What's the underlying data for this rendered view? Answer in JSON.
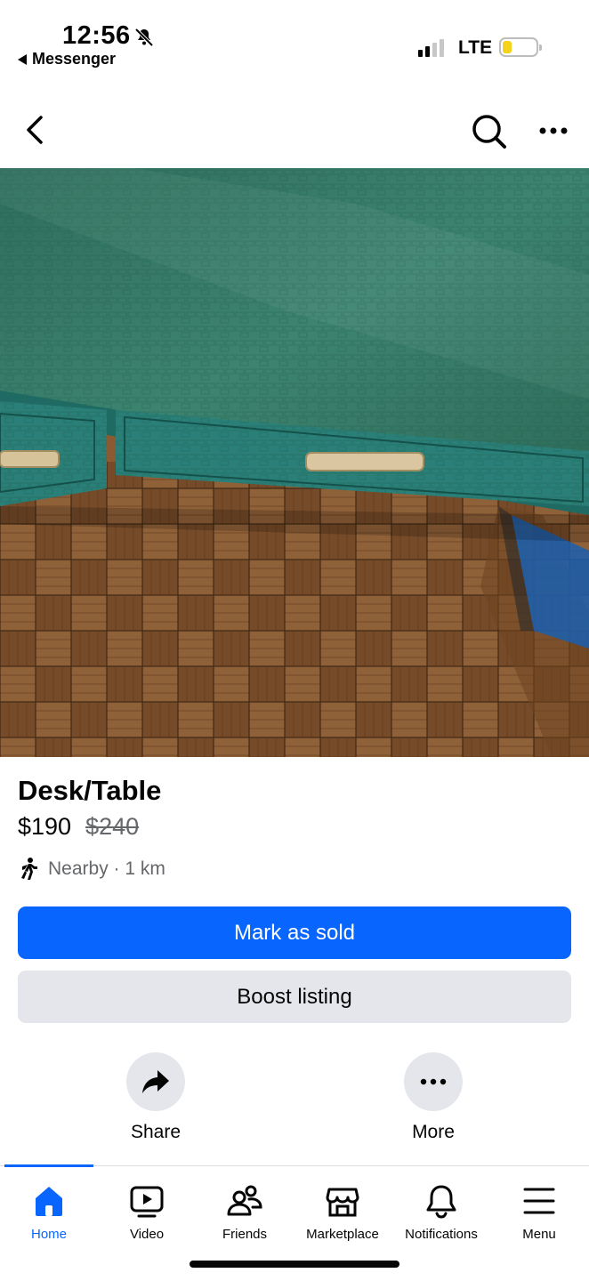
{
  "status_bar": {
    "time": "12:56",
    "back_app_label": "Messenger",
    "network": "LTE",
    "battery_color": "#f5d21c"
  },
  "top_nav": {
    "back_icon": "chevron-left-icon",
    "search_icon": "search-icon",
    "more_icon": "more-horizontal-icon"
  },
  "photo": {
    "icon": "listing-photo"
  },
  "listing": {
    "title": "Desk/Table",
    "price": "$190",
    "original_price": "$240",
    "location": "Nearby · 1 km",
    "location_icon": "walking-person-icon"
  },
  "actions": {
    "mark_sold": "Mark as sold",
    "boost": "Boost listing",
    "share": "Share",
    "more": "More"
  },
  "tabs": [
    {
      "label": "Home",
      "icon": "home-icon",
      "active": true
    },
    {
      "label": "Video",
      "icon": "video-icon",
      "active": false
    },
    {
      "label": "Friends",
      "icon": "friends-icon",
      "active": false
    },
    {
      "label": "Marketplace",
      "icon": "marketplace-icon",
      "active": false
    },
    {
      "label": "Notifications",
      "icon": "bell-icon",
      "active": false
    },
    {
      "label": "Menu",
      "icon": "menu-icon",
      "active": false
    }
  ],
  "colors": {
    "accent": "#0866ff",
    "secondary_button": "#e4e6eb",
    "muted_text": "#65676b"
  }
}
